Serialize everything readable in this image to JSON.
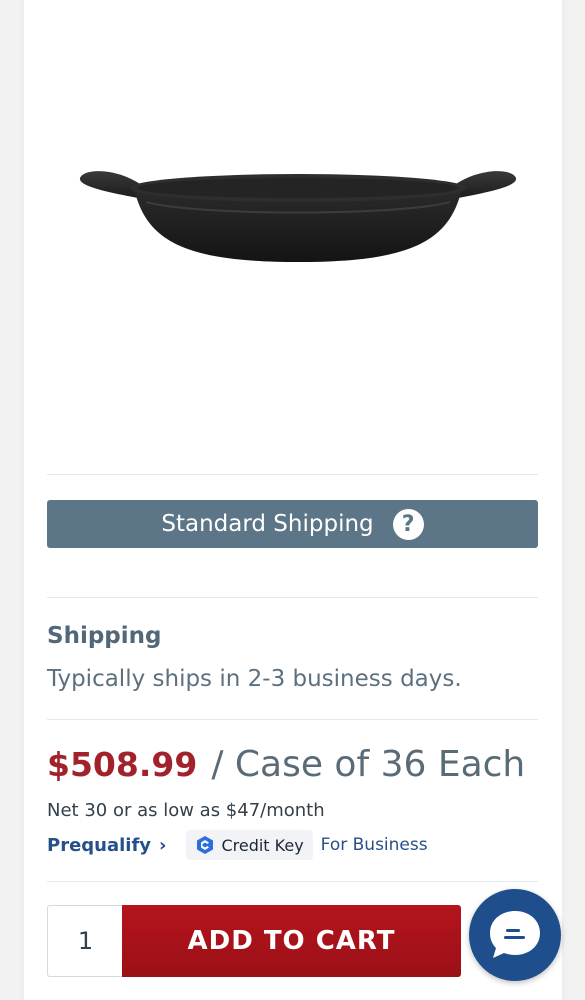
{
  "product": {
    "image_icon": "oval-cast-iron-dish-image"
  },
  "shipping_bar": {
    "label": "Standard Shipping",
    "help_glyph": "?"
  },
  "shipping_info": {
    "heading": "Shipping",
    "text": "Typically ships in 2-3 business days."
  },
  "pricing": {
    "price": "$508.99",
    "unit": "/ Case of 36 Each",
    "financing_text": "Net 30 or as low as $47/month"
  },
  "financing": {
    "prequalify_label": "Prequalify",
    "chevron_glyph": "›",
    "credit_key_label": "Credit Key",
    "for_business_label": "For Business"
  },
  "cart": {
    "quantity": "1",
    "add_label": "ADD TO CART"
  },
  "chat": {
    "icon": "chat-bubble-icon"
  },
  "colors": {
    "price_red": "#a1222b",
    "shipping_bar": "#5c7587",
    "cart_red": "#b5141d",
    "chat_blue": "#1e4f8c",
    "link_blue": "#26508a"
  }
}
